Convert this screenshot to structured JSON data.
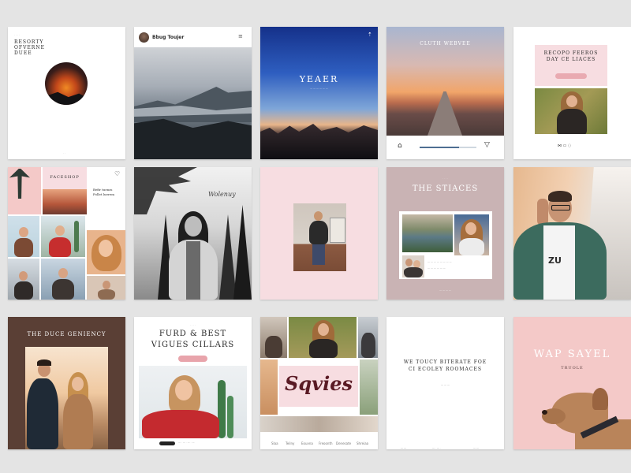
{
  "tiles": {
    "t1": {
      "lines": [
        "RESORTY",
        "OFVERNE",
        "DUEE"
      ]
    },
    "t2": {
      "handle": "Bbug Toujer"
    },
    "t3": {
      "title": "YEAER"
    },
    "t4": {
      "title": "CLUTH WEBVEE"
    },
    "t5": {
      "lines": [
        "RECOPO FEEROS",
        "DAY CE LIACES"
      ]
    },
    "t6": {
      "header": "FACESHOP",
      "side_lines": [
        "Befir tuenzs",
        "Pollet luerem"
      ]
    },
    "t7": {
      "script": "Wolenuy"
    },
    "t9": {
      "title": "THE STIACES"
    },
    "t11": {
      "title": "THE DUCE GENIENCY"
    },
    "t12": {
      "lines": [
        "FURD & BEST",
        "VIGUES CILLARS"
      ]
    },
    "t13": {
      "brand": "Sqvies",
      "nav": [
        "Slaa",
        "Teilny",
        "Eouvna",
        "Freoonth",
        "Denesate",
        "Shreiaa"
      ]
    },
    "t14": {
      "lines": [
        "WE TOUCY BITERATE FOE",
        "CI ECOLEY ROOMACES"
      ]
    },
    "t15": {
      "title": "WAP SAYEL",
      "sub": "TRUOLE"
    }
  },
  "colors": {
    "pink": "#f7dde1",
    "mauve": "#c9b3b4",
    "brown": "#5a3f35",
    "salmon": "#f4c9c8"
  }
}
